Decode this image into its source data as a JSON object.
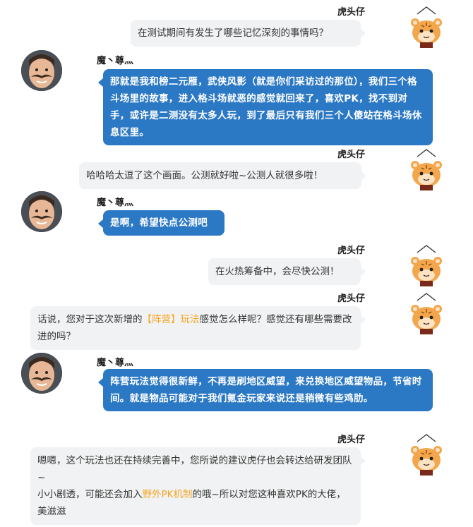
{
  "speakers": {
    "interviewer": "虎头仔",
    "player": "魔丶尊灬"
  },
  "messages": [
    {
      "from": "interviewer",
      "text": "在测试期间有发生了哪些记忆深刻的事情吗？"
    },
    {
      "from": "player",
      "text": "那就是我和榜二元雁，武侠风影（就是你们采访过的那位），我们三个格斗场里的故事，进入格斗场就恶的感觉就回来了，喜欢PK，找不到对手，或许是二测没有太多人玩，到了最后只有我们三个人傻站在格斗场休息区里。"
    },
    {
      "from": "interviewer",
      "text": "哈哈哈太逗了这个画面。公测就好啦~公测人就很多啦！"
    },
    {
      "from": "player",
      "text": "是啊，希望快点公测吧"
    },
    {
      "from": "interviewer",
      "text": "在火热筹备中，会尽快公测！"
    },
    {
      "from": "interviewer",
      "text_before": "话说，您对于这次新增的",
      "highlight": "【阵营】玩法",
      "text_after": "感觉怎么样呢？感觉还有哪些需要改进的吗？"
    },
    {
      "from": "player",
      "text": "阵营玩法觉得很新鲜，不再是刷地区威望，来兑换地区威望物品，节省时间。就是物品可能对于我们氪金玩家来说还是稍微有些鸡肋。"
    },
    {
      "from": "interviewer",
      "text": "嗯嗯，这个玩法也还在持续完善中，您所说的建议虎仔也会转达给研发团队~",
      "text2_before": "小小剧透，可能还会加入",
      "highlight": "野外PK机制",
      "text2_after": "的哦~所以对您这种喜欢PK的大佬，美滋滋"
    }
  ],
  "colors": {
    "player_bubble": "#2b78c5",
    "interviewer_bubble": "#f1f2f3",
    "highlight": "#f5a623"
  },
  "avatars": {
    "interviewer": "tiger-avatar-icon",
    "player": "mustache-man-avatar-icon"
  }
}
